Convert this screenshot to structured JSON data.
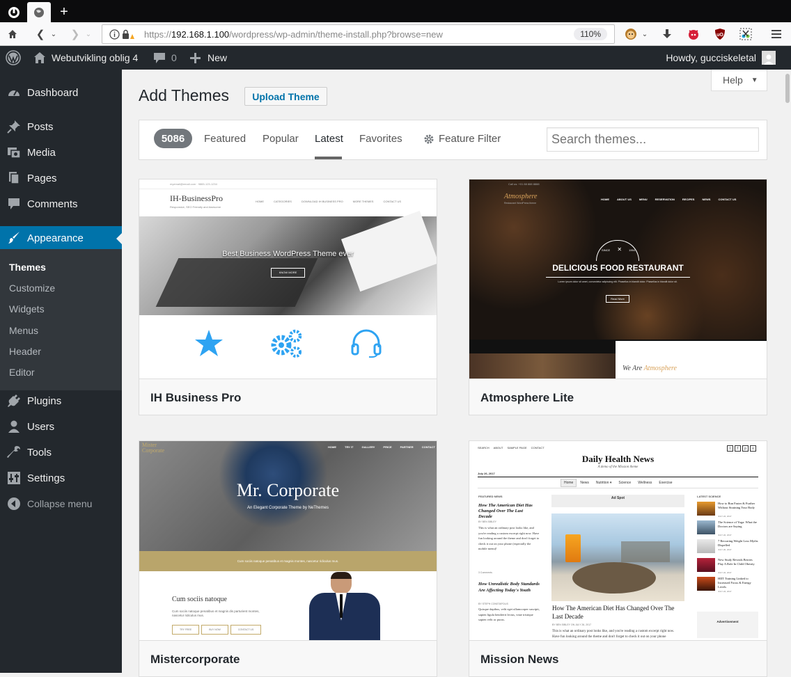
{
  "browser": {
    "url_scheme": "https://",
    "url_host": "192.168.1.100",
    "url_path": "/wordpress/wp-admin/theme-install.php?browse=new",
    "zoom": "110%"
  },
  "adminbar": {
    "site_name": "Webutvikling oblig 4",
    "comments_count": "0",
    "new_label": "New",
    "howdy": "Howdy, gucciskeletal"
  },
  "sidebar": {
    "items": [
      {
        "label": "Dashboard"
      },
      {
        "label": "Posts"
      },
      {
        "label": "Media"
      },
      {
        "label": "Pages"
      },
      {
        "label": "Comments"
      },
      {
        "label": "Appearance"
      },
      {
        "label": "Plugins"
      },
      {
        "label": "Users"
      },
      {
        "label": "Tools"
      },
      {
        "label": "Settings"
      },
      {
        "label": "Collapse menu"
      }
    ],
    "submenu": [
      "Themes",
      "Customize",
      "Widgets",
      "Menus",
      "Header",
      "Editor"
    ]
  },
  "help_label": "Help",
  "page": {
    "title": "Add Themes",
    "upload_label": "Upload Theme"
  },
  "filter": {
    "count": "5086",
    "tabs": [
      "Featured",
      "Popular",
      "Latest",
      "Favorites"
    ],
    "feature_filter": "Feature Filter",
    "search_placeholder": "Search themes..."
  },
  "themes": [
    {
      "name": "IH Business Pro",
      "shot": {
        "topbar_text": "myemail@email.com   ·   9865-123-1234",
        "logo": "IH-BusinessPro",
        "tagline": "Responsive, SEO Friendly and Awesome",
        "menu": [
          "HOME",
          "CATEGORIES",
          "DOWNLOAD IH BUSINESS PRO",
          "MORE THEMES",
          "CONTACT US"
        ],
        "hero": "Best Business WordPress Theme ever",
        "hero_btn": "KNOW MORE"
      }
    },
    {
      "name": "Atmosphere Lite",
      "shot": {
        "topbar_text": "Call us: +01 88 888 8888",
        "logo": "Atmosphere",
        "tagline": "Restaurant WordPress theme",
        "menu": [
          "HOME",
          "ABOUT US",
          "MENU",
          "RESERVATION",
          "RECIPES",
          "NEWS",
          "CONTACT US"
        ],
        "since": "SINCE",
        "year": "1994",
        "hero": "DELICIOUS FOOD RESTAURANT",
        "hero_sub": "Lorem ipsum dolor sit amet, consectetur adipiscing elit. Phasellus in blandit dolor. Phasellus in blandit dolor sit.",
        "hero_btn": "Read More",
        "footer_text": "We Are",
        "footer_brand": "Atmosphere"
      }
    },
    {
      "name": "Mistercorporate",
      "shot": {
        "logo_line1": "Mister",
        "logo_line2": "Corporate",
        "menu": [
          "HOME",
          "TRY IT",
          "GALLERY",
          "PRICE",
          "PARTNER",
          "CONTACT"
        ],
        "hero": "Mr. Corporate",
        "hero_sub": "An Elegant Corporate Theme by NeThemes",
        "band": "Cum sociis natoque penatibus et magnis montes, nascetur ridiculus mus.",
        "heading": "Cum sociis natoque",
        "body": "Cum sociis natoque penatibus et magnis dis parturient montes, nascetur ridiculus mus.",
        "buttons": [
          "TRY FREE",
          "BUY NOW",
          "CONTACT US"
        ]
      }
    },
    {
      "name": "Mission News",
      "shot": {
        "top_links": [
          "SEARCH",
          "ABOUT",
          "SAMPLE PAGE",
          "CONTACT"
        ],
        "title": "Daily Health News",
        "tagline": "A demo of the Mission theme",
        "date": "July 26, 2017",
        "nav": [
          "Home",
          "News",
          "Nutrition ▾",
          "Science",
          "Wellness",
          "Exercise"
        ],
        "featured_label": "FEATURED NEWS",
        "ad_label": "Ad Spot",
        "latest_label": "LATEST SCIENCE",
        "articles": [
          {
            "title": "How The American Diet Has Changed Over The Last Decade",
            "by": "BY BEN SIBLEY"
          },
          {
            "title": "How Unrealistic Body Standards Are Affecting Today's Youth",
            "by": "BY STEPH CONSTAPOLIS"
          }
        ],
        "excerpt": "This is what an ordinary post looks like, and you're reading a custom excerpt right now. Have fun looking around the theme and don't forget to check it out on your phone (especially the mobile menu)!",
        "comments": "3 Comments",
        "lorem": "Quisque dapibus, velit eget ullamcorper suscipit, sapien ligula hendrerit lectus, vitae tristique sapien velit ac purus.",
        "center_title": "How The American Diet Has Changed Over The Last Decade",
        "center_by": "BY BEN SIBLEY ON JULY 26, 2017",
        "latest": [
          {
            "title": "How to Run Faster & Further Without Straining Your Body",
            "date": "JULY 24, 2017"
          },
          {
            "title": "The Science of Yoga: What the Doctors are Saying",
            "date": "JULY 22, 2017"
          },
          {
            "title": "7 Recurring Weight Loss Myths Dispelled",
            "date": "JULY 20, 2017"
          },
          {
            "title": "New Study Reveals Berries Play A Role In Child Obesity",
            "date": "JULY 22, 2017"
          },
          {
            "title": "HIIT Training Linked to Increased Focus & Energy Levels",
            "date": "JULY 24, 2017"
          }
        ],
        "advert": "Advertisement"
      }
    }
  ]
}
